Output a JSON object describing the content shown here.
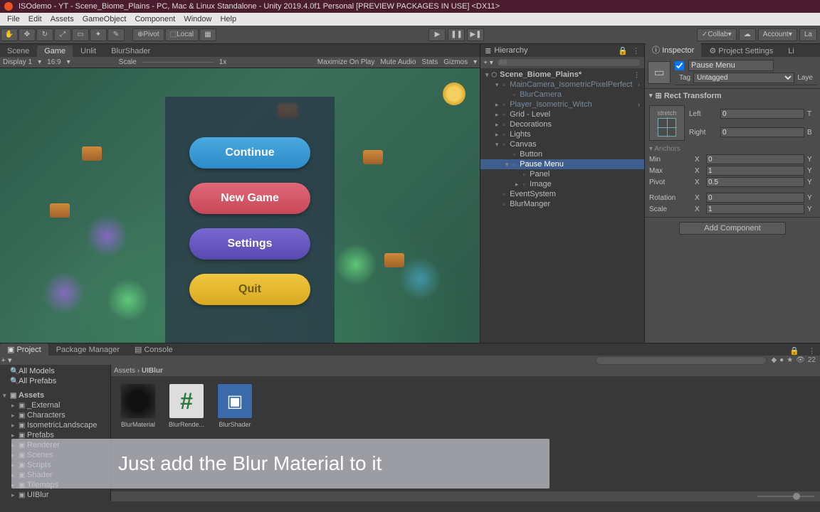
{
  "window": {
    "title": "ISOdemo - YT - Scene_Biome_Plains - PC, Mac & Linux Standalone - Unity 2019.4.0f1 Personal [PREVIEW PACKAGES IN USE] <DX11>"
  },
  "menubar": [
    "File",
    "Edit",
    "Assets",
    "GameObject",
    "Component",
    "Window",
    "Help"
  ],
  "toolbar": {
    "pivot": "Pivot",
    "local": "Local",
    "collab": "Collab",
    "account": "Account",
    "layers": "La"
  },
  "view": {
    "tabs": [
      "Scene",
      "Game",
      "Unlit",
      "BlurShader"
    ],
    "active_tab": 1,
    "display": "Display 1",
    "aspect": "16:9",
    "scale_label": "Scale",
    "scale_value": "1x",
    "maximize": "Maximize On Play",
    "mute": "Mute Audio",
    "stats": "Stats",
    "gizmos": "Gizmos"
  },
  "pausemenu": {
    "continue": "Continue",
    "newgame": "New Game",
    "settings": "Settings",
    "quit": "Quit"
  },
  "hierarchy": {
    "title": "Hierarchy",
    "search_placeholder": "All",
    "scene": "Scene_Biome_Plains*",
    "nodes": [
      {
        "label": "MainCamera_IsometricPixelPerfect",
        "depth": 1,
        "expand": "▾",
        "dim": true,
        "chev": true
      },
      {
        "label": "BlurCamera",
        "depth": 2,
        "dim": true
      },
      {
        "label": "Player_Isometric_Witch",
        "depth": 1,
        "expand": "▸",
        "dim": true,
        "chev": true
      },
      {
        "label": "Grid - Level",
        "depth": 1,
        "expand": "▸"
      },
      {
        "label": "Decorations",
        "depth": 1,
        "expand": "▸"
      },
      {
        "label": "Lights",
        "depth": 1,
        "expand": "▸"
      },
      {
        "label": "Canvas",
        "depth": 1,
        "expand": "▾"
      },
      {
        "label": "Button",
        "depth": 2
      },
      {
        "label": "Pause Menu",
        "depth": 2,
        "expand": "▾",
        "sel": true
      },
      {
        "label": "Panel",
        "depth": 3
      },
      {
        "label": "Image",
        "depth": 3,
        "expand": "▸"
      },
      {
        "label": "EventSystem",
        "depth": 1
      },
      {
        "label": "BlurManger",
        "depth": 1
      }
    ]
  },
  "inspector": {
    "tabs": [
      "Inspector",
      "Project Settings",
      "Li"
    ],
    "active_tab": 0,
    "obj_name": "Pause Menu",
    "enabled": true,
    "tag_label": "Tag",
    "tag_value": "Untagged",
    "layer_label": "Laye",
    "rect": {
      "title": "Rect Transform",
      "stretch": "stretch",
      "left_label": "Left",
      "left": "0",
      "t_label": "T",
      "right_label": "Right",
      "right": "0",
      "b_label": "B",
      "anchors": "Anchors",
      "min_label": "Min",
      "min_x": "0",
      "max_label": "Max",
      "max_x": "1",
      "pivot_label": "Pivot",
      "pivot_x": "0.5",
      "rotation_label": "Rotation",
      "rotation_x": "0",
      "scale_label": "Scale",
      "scale_x": "1"
    },
    "addcomp": "Add Component"
  },
  "project": {
    "tabs": [
      "Project",
      "Package Manager",
      "Console"
    ],
    "active_tab": 0,
    "favorites": [
      "All Models",
      "All Prefabs"
    ],
    "assets_label": "Assets",
    "folders": [
      "_External",
      "Characters",
      "IsometricLandscape",
      "Prefabs",
      "Renderer",
      "Scenes",
      "Scripts",
      "Shader",
      "Tilemaps",
      "UIBlur"
    ],
    "breadcrumb": [
      "Assets",
      "UIBlur"
    ],
    "items": [
      {
        "name": "BlurMaterial",
        "type": "material"
      },
      {
        "name": "BlurRende...",
        "type": "script"
      },
      {
        "name": "BlurShader",
        "type": "shader"
      }
    ],
    "hidden_count": "22"
  },
  "overlay": "Just add the Blur Material to it"
}
